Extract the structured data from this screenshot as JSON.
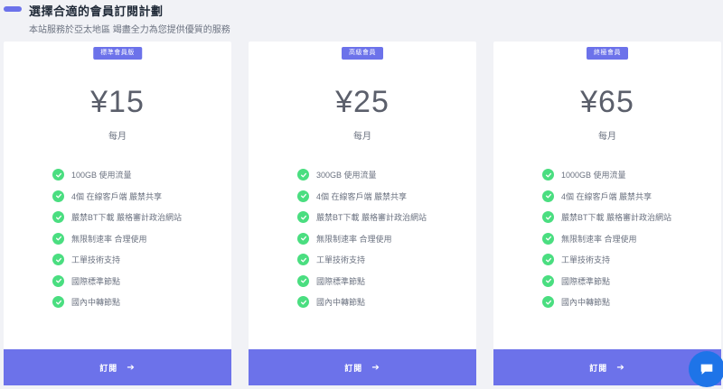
{
  "header": {
    "title": "選擇合適的會員訂閱計劃",
    "subtitle": "本站服務於亞太地區 竭盡全力為您提供優質的服務"
  },
  "plans": [
    {
      "badge": "標準會員版",
      "price": "¥15",
      "period": "每月",
      "features": [
        "100GB 使用流量",
        "4個 在線客戶端 嚴禁共享",
        "嚴禁BT下載 嚴格審計政治網站",
        "無限制速率 合理使用",
        "工單技術支持",
        "國際標準節點",
        "國內中轉節點"
      ],
      "button": "訂閱"
    },
    {
      "badge": "高級會員",
      "price": "¥25",
      "period": "每月",
      "features": [
        "300GB 使用流量",
        "4個 在線客戶端 嚴禁共享",
        "嚴禁BT下載 嚴格審計政治網站",
        "無限制速率 合理使用",
        "工單技術支持",
        "國際標準節點",
        "國內中轉節點"
      ],
      "button": "訂閱"
    },
    {
      "badge": "終極會員",
      "price": "¥65",
      "period": "每月",
      "features": [
        "1000GB 使用流量",
        "4個 在線客戶端 嚴禁共享",
        "嚴禁BT下載 嚴格審計政治網站",
        "無限制速率 合理使用",
        "工單技術支持",
        "國際標準節點",
        "國內中轉節點"
      ],
      "button": "訂閱"
    }
  ],
  "icons": {
    "feature": "check-circle-icon",
    "button_arrow": "arrow-right-icon",
    "chat": "chat-icon"
  },
  "colors": {
    "accent": "#6c72ea",
    "check": "#4ade80",
    "chat": "#1e74e8"
  }
}
